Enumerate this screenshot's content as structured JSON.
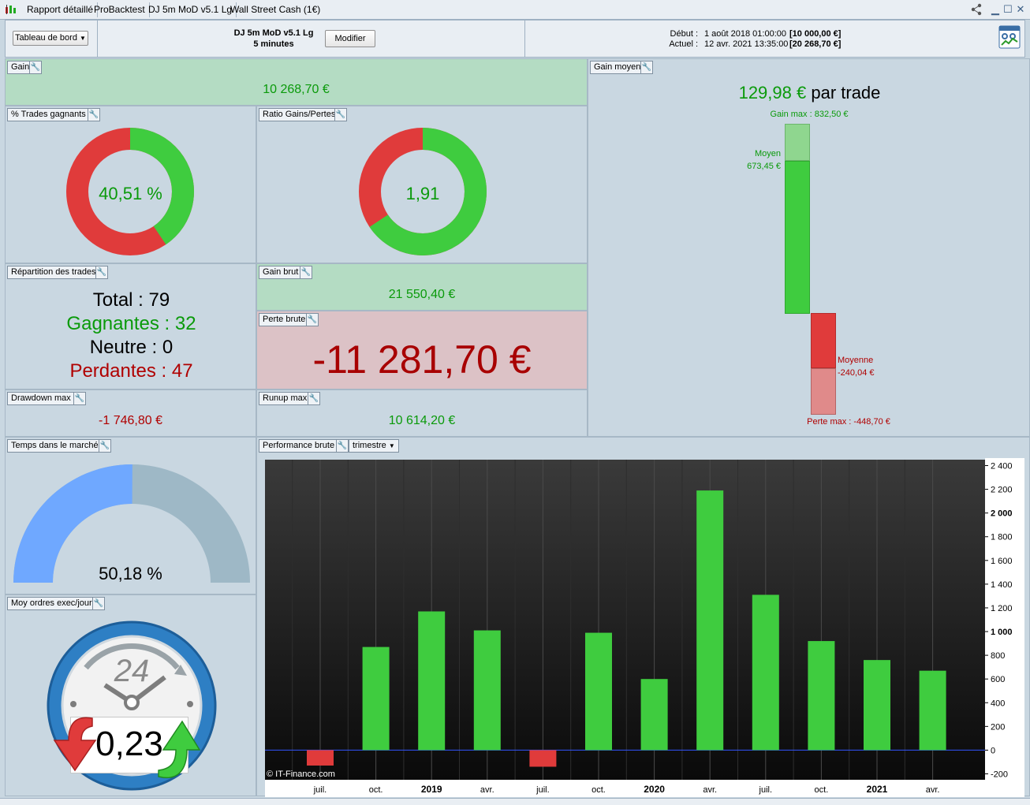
{
  "tabs": [
    "Rapport détaillé",
    "ProBacktest",
    "DJ 5m MoD v5.1 Lg",
    "Wall Street Cash (1€)"
  ],
  "header": {
    "dropdown_label": "Tableau de bord",
    "system_name": "DJ 5m MoD v5.1 Lg",
    "timeframe": "5 minutes",
    "modify_label": "Modifier",
    "start_label": "Début :",
    "start_date": "1 août 2018 01:00:00",
    "start_value": "[10 000,00 €]",
    "current_label": "Actuel :",
    "current_date": "12 avr. 2021 13:35:00",
    "current_value": "[20 268,70 €]"
  },
  "gain": {
    "title": "Gain",
    "value": "10 268,70 €"
  },
  "win_pct": {
    "title": "% Trades gagnants",
    "value": "40,51 %",
    "fraction": 0.4051
  },
  "ratio": {
    "title": "Ratio Gains/Pertes",
    "value": "1,91",
    "fraction": 0.6564
  },
  "avg_gain": {
    "title": "Gain moyen",
    "value": "129,98 €",
    "suffix": "par trade",
    "gain_max_label": "Gain max : 832,50 €",
    "moyen_label": "Moyen",
    "moyen_value": "673,45 €",
    "moyenne_label": "Moyenne",
    "moyenne_value": "-240,04 €",
    "perte_max_label": "Perte max : -448,70 €"
  },
  "repartition": {
    "title": "Répartition des trades",
    "total_label": "Total :",
    "total": "79",
    "won_label": "Gagnantes :",
    "won": "32",
    "neutral_label": "Neutre :",
    "neutral": "0",
    "lost_label": "Perdantes :",
    "lost": "47"
  },
  "gross_gain": {
    "title": "Gain brut",
    "value": "21 550,40 €"
  },
  "gross_loss": {
    "title": "Perte brute",
    "value": "-11 281,70 €"
  },
  "drawdown": {
    "title": "Drawdown max",
    "value": "-1 746,80 €"
  },
  "runup": {
    "title": "Runup max",
    "value": "10 614,20 €"
  },
  "time_in_market": {
    "title": "Temps dans le marché",
    "value": "50,18 %",
    "fraction": 0.5018
  },
  "orders": {
    "title": "Moy ordres exec/jour",
    "clock_label": "24",
    "value": "0,23"
  },
  "perf": {
    "title": "Performance brute",
    "period": "trimestre",
    "copyright": "© IT-Finance.com"
  },
  "colors": {
    "green": "#3fcc3f",
    "red": "#e03b3b",
    "text_green": "#0a9a0a",
    "text_red": "#b00000"
  },
  "chart_data": {
    "type": "bar",
    "categories": [
      "juil.",
      "oct.",
      "2019",
      "avr.",
      "juil.",
      "oct.",
      "2020",
      "avr.",
      "juil.",
      "oct.",
      "2021",
      "avr."
    ],
    "values": [
      -130,
      870,
      1170,
      1010,
      -140,
      990,
      600,
      2190,
      1310,
      920,
      760,
      670
    ],
    "ylim": [
      -250,
      2450
    ],
    "yticks": [
      "2 400",
      "2 200",
      "2 000",
      "1 800",
      "1 600",
      "1 400",
      "1 200",
      "1 000",
      "800",
      "600",
      "400",
      "200",
      "0",
      "-200"
    ],
    "ytick_values": [
      2400,
      2200,
      2000,
      1800,
      1600,
      1400,
      1200,
      1000,
      800,
      600,
      400,
      200,
      0,
      -200
    ],
    "bold_labels": [
      "2019",
      "2020",
      "2021"
    ],
    "title": "",
    "xlabel": "",
    "ylabel": ""
  }
}
